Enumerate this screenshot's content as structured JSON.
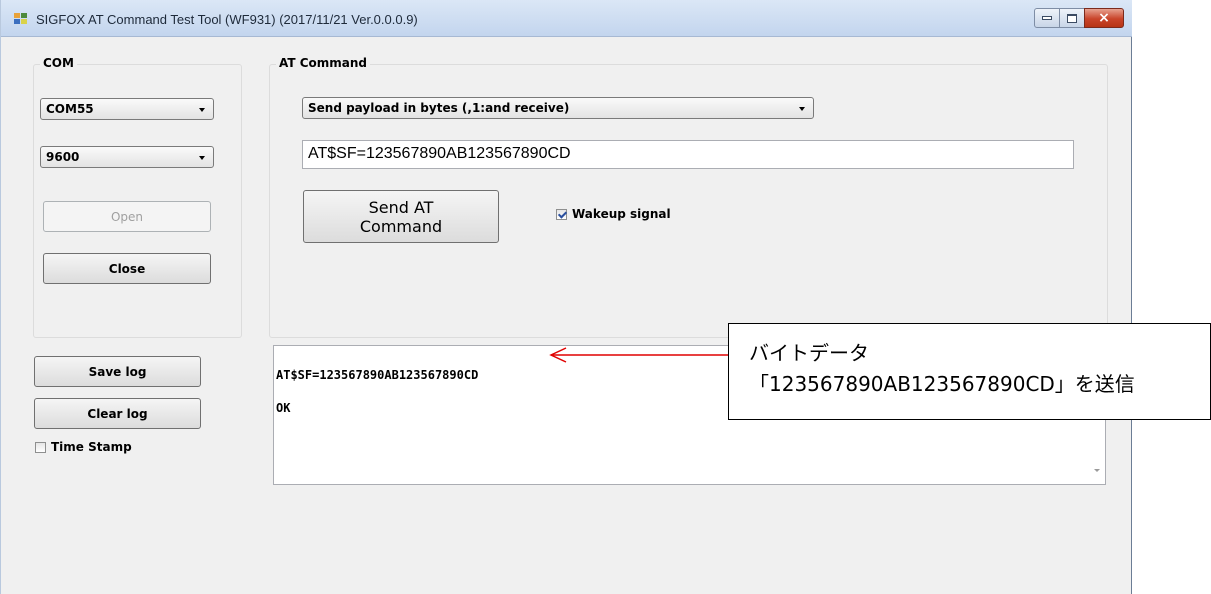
{
  "window": {
    "title": "SIGFOX AT Command Test Tool  (WF931) (2017/11/21 Ver.0.0.0.9)",
    "controls": {
      "minimize": "minimize-icon",
      "maximize": "maximize-icon",
      "close": "×"
    }
  },
  "com_group": {
    "label": "COM",
    "port_select": "COM55",
    "baud_select": "9600",
    "open_label": "Open",
    "close_label": "Close"
  },
  "at_group": {
    "label": "AT Command",
    "command_select": "Send payload in bytes (,1:and receive)",
    "command_input": "AT$SF=123567890AB123567890CD",
    "send_label_line1": "Send AT",
    "send_label_line2": "Command",
    "wakeup_label": "Wakeup signal",
    "wakeup_checked": true
  },
  "log_controls": {
    "save_label": "Save log",
    "clear_label": "Clear log",
    "timestamp_label": "Time Stamp",
    "timestamp_checked": false
  },
  "log": {
    "lines": [
      "AT$SF=123567890AB123567890CD",
      "OK"
    ]
  },
  "annotation": {
    "line1": "バイトデータ",
    "line2": "「123567890AB123567890CD」を送信",
    "arrow_color": "#e00000"
  }
}
